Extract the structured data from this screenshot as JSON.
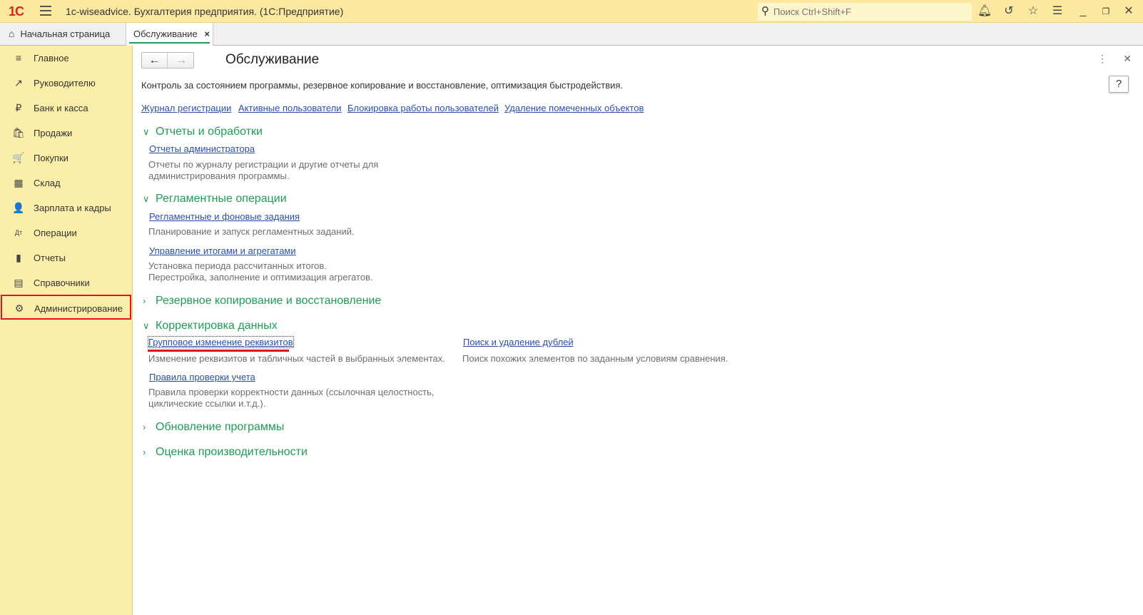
{
  "app": {
    "title": "1c-wiseadvice. Бухгалтерия предприятия.  (1С:Предприятие)",
    "logo": "1C",
    "search_placeholder": "Поиск Ctrl+Shift+F"
  },
  "tabs": [
    {
      "label": "Начальная страница"
    },
    {
      "label": "Обслуживание",
      "close": "×"
    }
  ],
  "sidebar": {
    "items": [
      {
        "label": "Главное",
        "icon": "≡"
      },
      {
        "label": "Руководителю",
        "icon": "↗"
      },
      {
        "label": "Банк и касса",
        "icon": "₽"
      },
      {
        "label": "Продажи",
        "icon": "🛍"
      },
      {
        "label": "Покупки",
        "icon": "🛒"
      },
      {
        "label": "Склад",
        "icon": "▦"
      },
      {
        "label": "Зарплата и кадры",
        "icon": "👤"
      },
      {
        "label": "Операции",
        "icon": "Дт"
      },
      {
        "label": "Отчеты",
        "icon": "▮"
      },
      {
        "label": "Справочники",
        "icon": "▤"
      },
      {
        "label": "Администрирование",
        "icon": "⚙",
        "selected": true
      }
    ]
  },
  "page": {
    "title": "Обслуживание",
    "description": "Контроль за состоянием программы, резервное копирование и восстановление, оптимизация быстродействия.",
    "help": "?",
    "top_links": [
      "Журнал регистрации",
      "Активные пользователи",
      "Блокировка работы пользователей",
      "Удаление помеченных объектов"
    ],
    "sections": {
      "reports": {
        "title": "Отчеты и обработки",
        "link": "Отчеты администратора",
        "desc1": "Отчеты по журналу регистрации и другие отчеты для",
        "desc2": "администрирования программы."
      },
      "routine": {
        "title": "Регламентные операции",
        "link1": "Регламентные и фоновые задания",
        "desc1": "Планирование и запуск регламентных заданий.",
        "link2": "Управление итогами и агрегатами",
        "desc2a": "Установка периода рассчитанных итогов.",
        "desc2b": "Перестройка, заполнение и оптимизация агрегатов."
      },
      "backup": {
        "title": "Резервное копирование и восстановление"
      },
      "correction": {
        "title": "Корректировка данных",
        "link1": "Групповое изменение реквизитов",
        "desc1": "Изменение реквизитов и табличных частей в выбранных элементах.",
        "link2": "Поиск и удаление дублей",
        "desc2": "Поиск похожих элементов по заданным условиям сравнения.",
        "link3": "Правила проверки учета",
        "desc3a": "Правила проверки корректности данных (ссылочная целостность,",
        "desc3b": "циклические ссылки и.т.д.)."
      },
      "update": {
        "title": "Обновление программы"
      },
      "performance": {
        "title": "Оценка производительности"
      }
    }
  }
}
